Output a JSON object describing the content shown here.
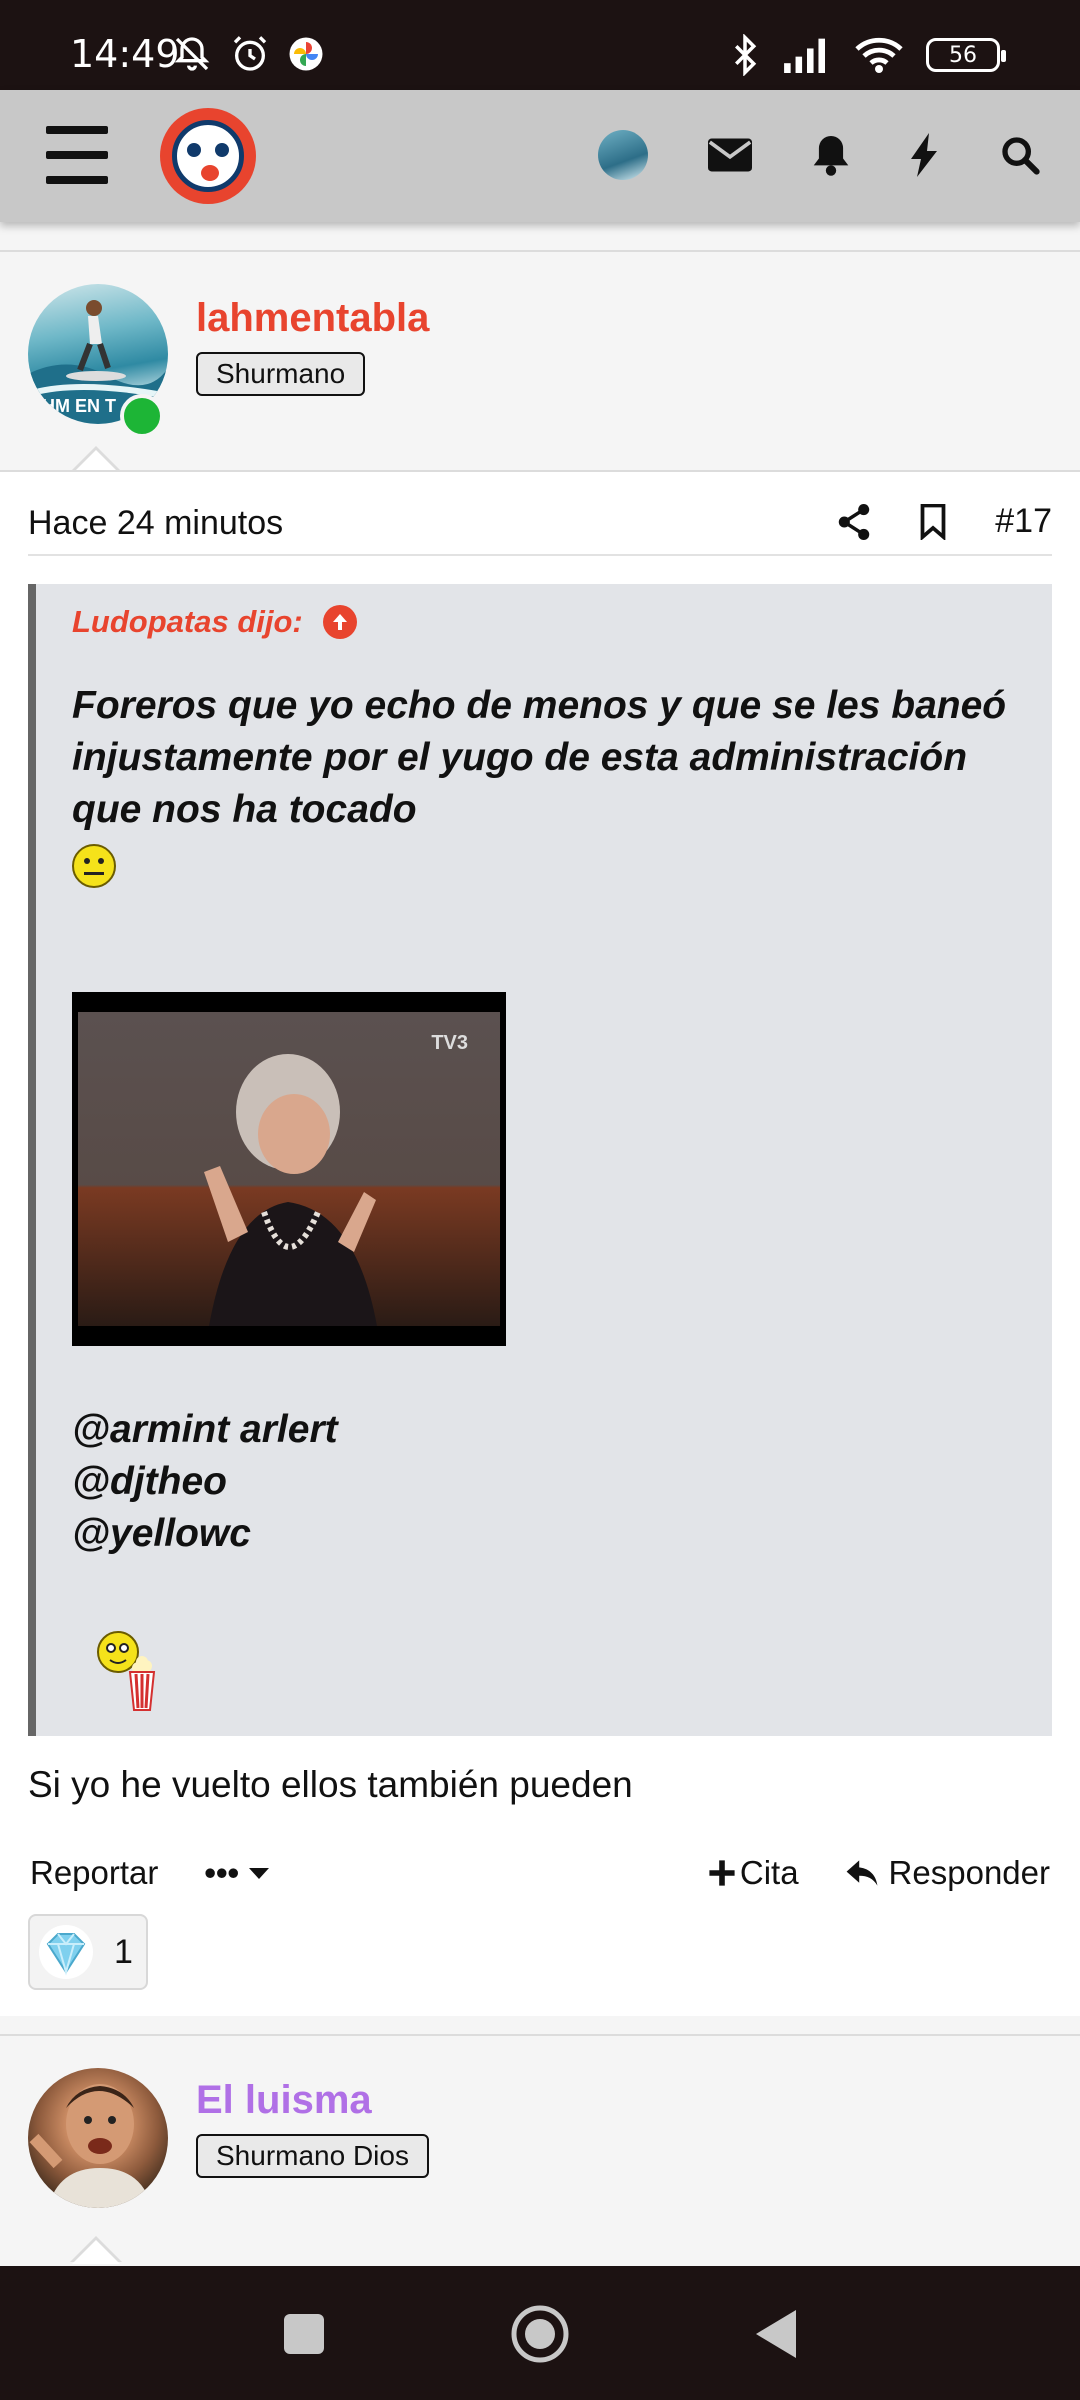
{
  "status_bar": {
    "time": "14:49",
    "battery": "56",
    "left_icons": [
      "bell-off-icon",
      "alarm-icon",
      "photos-icon"
    ],
    "right_icons": [
      "bluetooth-icon",
      "signal-icon",
      "wifi-icon",
      "battery-icon"
    ]
  },
  "header": {
    "icons": [
      "menu-icon",
      "site-logo",
      "user-avatar",
      "envelope-icon",
      "bell-icon",
      "bolt-icon",
      "search-icon"
    ]
  },
  "post": {
    "author": "lahmentabla",
    "author_color": "#e8442e",
    "rank": "Shurmano",
    "avatar_caption": "HM EN T",
    "online": true,
    "time": "Hace 24 minutos",
    "number": "#17",
    "quote": {
      "author_label": "Ludopatas dijo:",
      "text": "Foreros que yo echo de menos y que se les baneó injustamente por el yugo de esta administración que nos ha tocado",
      "gif_watermark": "TV3",
      "mentions": [
        "@armint arlert",
        "@djtheo",
        "@yellowc"
      ]
    },
    "reply": "Si yo he vuelto ellos también pueden",
    "actions": {
      "report": "Reportar",
      "more": "•••",
      "quote": "Cita",
      "reply": "Responder"
    },
    "reaction_count": "1"
  },
  "next_post": {
    "author": "El luisma",
    "author_color": "#b070e6",
    "rank": "Shurmano Dios"
  },
  "colors": {
    "accent": "#e8442e",
    "online": "#1db536",
    "quote_bg": "#e2e4e8"
  }
}
